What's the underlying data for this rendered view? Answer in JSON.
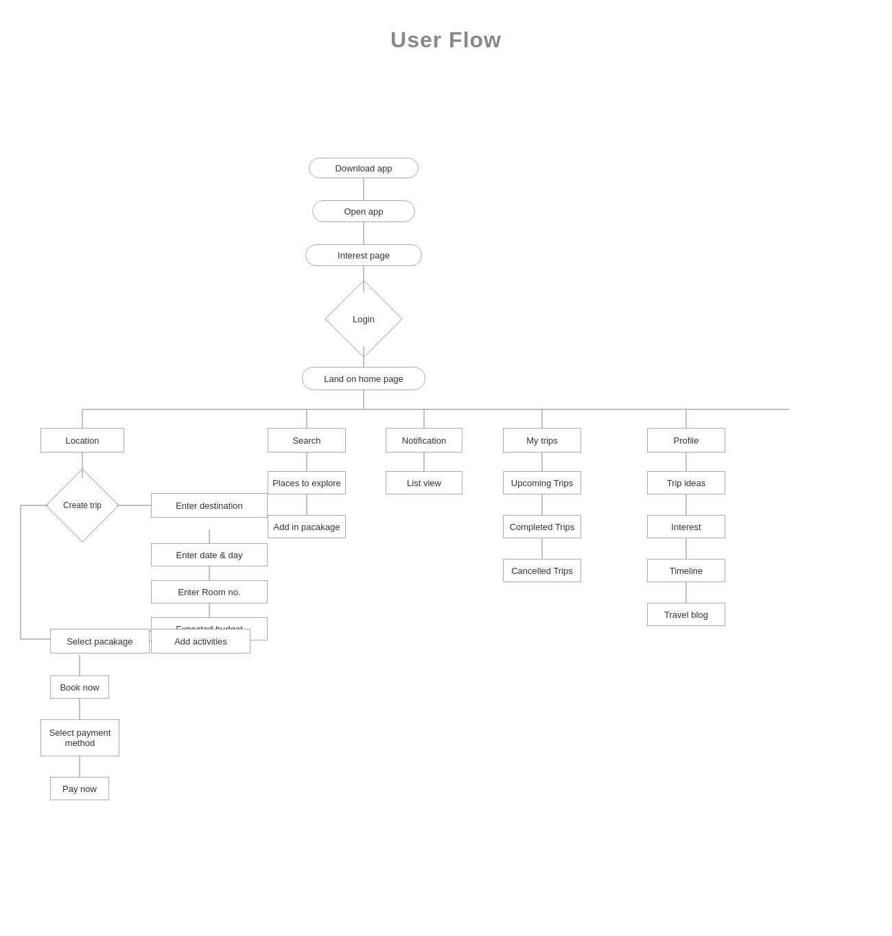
{
  "title": "User Flow",
  "nodes": {
    "download_app": {
      "label": "Download app"
    },
    "open_app": {
      "label": "Open app"
    },
    "interest_page": {
      "label": "Interest page"
    },
    "login": {
      "label": "Login"
    },
    "land_home": {
      "label": "Land on home page"
    },
    "location": {
      "label": "Location"
    },
    "search": {
      "label": "Search"
    },
    "notification": {
      "label": "Notification"
    },
    "my_trips": {
      "label": "My trips"
    },
    "profile": {
      "label": "Profile"
    },
    "create_trip": {
      "label": "Create\ntrip"
    },
    "places_to_explore": {
      "label": "Places to explore"
    },
    "list_view": {
      "label": "List view"
    },
    "upcoming_trips": {
      "label": "Upcoming Trips"
    },
    "trip_ideas": {
      "label": "Trip ideas"
    },
    "enter_destination": {
      "label": "Enter destination"
    },
    "add_in_package": {
      "label": "Add in pacakage"
    },
    "completed_trips": {
      "label": "Completed Trips"
    },
    "interest": {
      "label": "Interest"
    },
    "enter_date": {
      "label": "Enter date & day"
    },
    "cancelled_trips": {
      "label": "Cancelled Trips"
    },
    "timeline": {
      "label": "Timeline"
    },
    "enter_room": {
      "label": "Enter Room no."
    },
    "travel_blog": {
      "label": "Travel blog"
    },
    "expected_budget": {
      "label": "Expected budget"
    },
    "select_package": {
      "label": "Select pacakage"
    },
    "add_activities": {
      "label": "Add activities"
    },
    "book_now": {
      "label": "Book now"
    },
    "select_payment": {
      "label": "Select payment\nmethod"
    },
    "pay_now": {
      "label": "Pay now"
    }
  }
}
